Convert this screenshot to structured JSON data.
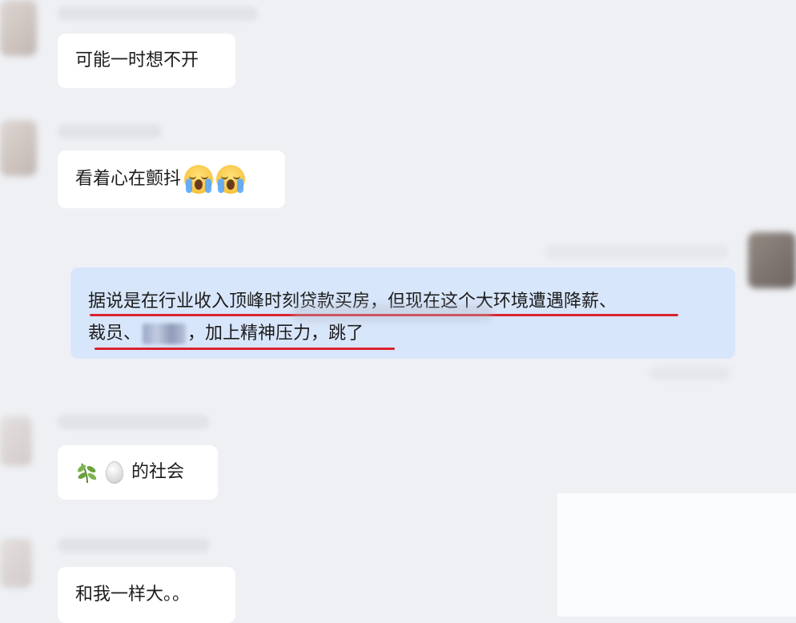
{
  "messages": [
    {
      "text": "可能一时想不开"
    },
    {
      "text": "看着心在颤抖",
      "emoji": [
        "crying-face",
        "crying-face"
      ]
    },
    {
      "line1": "据说是在行业收入顶峰时刻贷款买房，但现在这个大环境遭遇降薪、",
      "line2_prefix": "裁员、",
      "line2_suffix": "，加上精神压力，跳了",
      "highlight_color": "#d9232e"
    },
    {
      "icons": [
        "leaf-icon",
        "egg-icon"
      ],
      "text": "的社会"
    },
    {
      "text": "和我一样大。。"
    }
  ],
  "colors": {
    "background": "#eef0f4",
    "incoming_bubble": "#ffffff",
    "outgoing_bubble": "#d8e6fb"
  }
}
